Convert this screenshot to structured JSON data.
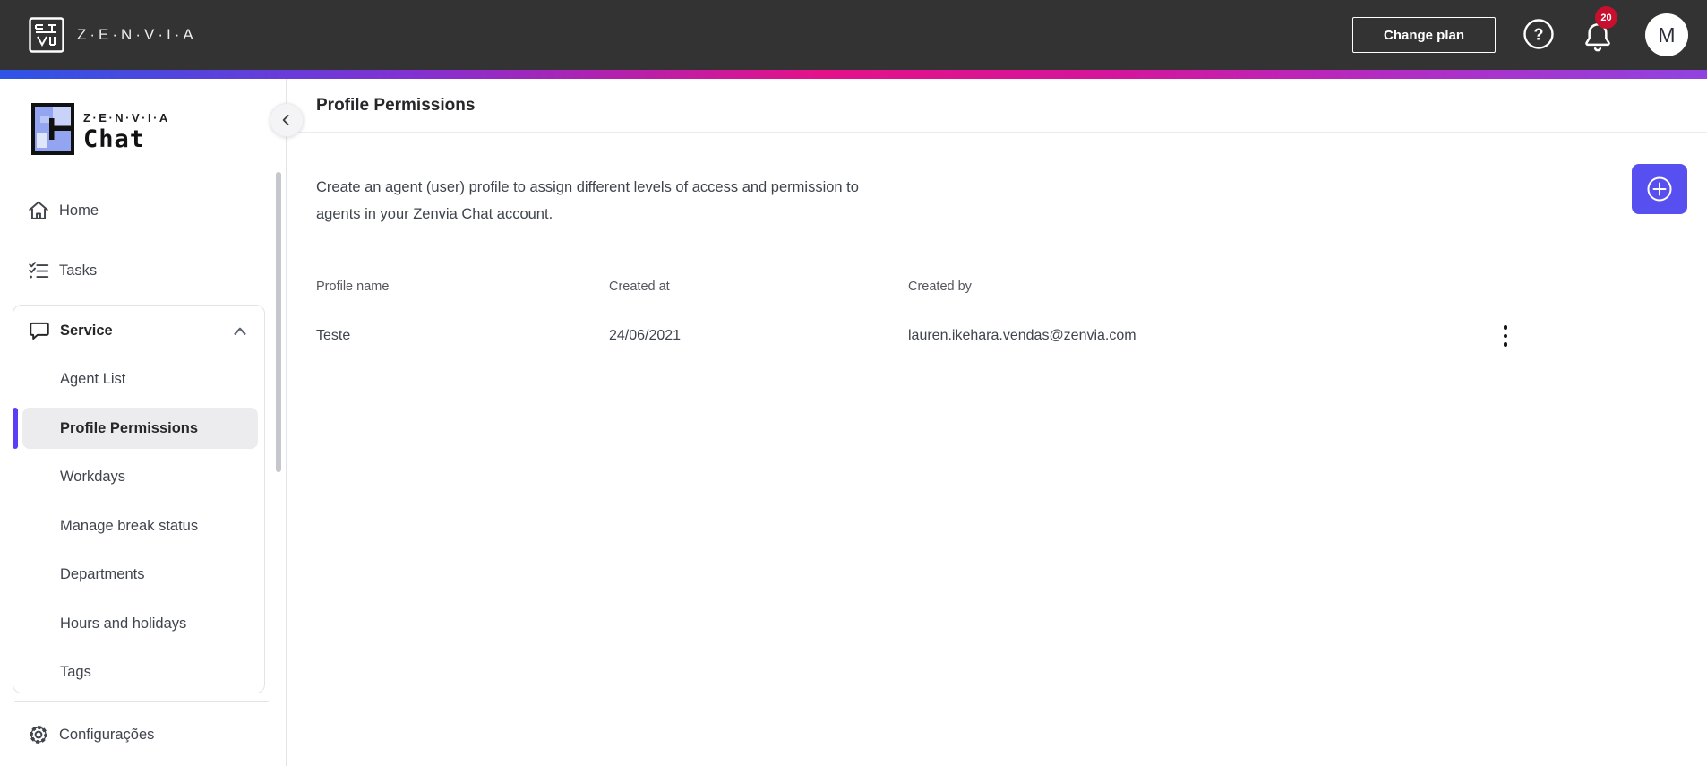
{
  "topbar": {
    "brand": "Z·E·N·V·I·A",
    "change_plan_label": "Change plan",
    "notification_count": "20",
    "avatar_initial": "M"
  },
  "sidebar": {
    "logo_brand": "Z·E·N·V·I·A",
    "logo_product": "Chat",
    "items": [
      {
        "label": "Home"
      },
      {
        "label": "Tasks"
      }
    ],
    "service_group": {
      "label": "Service",
      "items": [
        {
          "label": "Agent List",
          "active": false
        },
        {
          "label": "Profile Permissions",
          "active": true
        },
        {
          "label": "Workdays",
          "active": false
        },
        {
          "label": "Manage break status",
          "active": false
        },
        {
          "label": "Departments",
          "active": false
        },
        {
          "label": "Hours and holidays",
          "active": false
        },
        {
          "label": "Tags",
          "active": false
        }
      ]
    },
    "footer_item": {
      "label": "Configurações"
    }
  },
  "main": {
    "title": "Profile Permissions",
    "description": "Create an agent (user) profile to assign different levels of access and permission to agents in your Zenvia Chat account.",
    "table": {
      "columns": [
        "Profile name",
        "Created at",
        "Created by"
      ],
      "rows": [
        {
          "profile_name": "Teste",
          "created_at": "24/06/2021",
          "created_by": "lauren.ikehara.vendas@zenvia.com"
        }
      ]
    }
  },
  "icons": {
    "brand_mark": "zenvia-maze-logo",
    "help": "question-circle",
    "notifications": "bell",
    "home": "house",
    "tasks": "checklist",
    "service": "chat-bubble",
    "service_state": "chevron-up",
    "collapse": "chevron-left",
    "settings": "gear",
    "add": "plus-circle",
    "row_menu": "kebab-vertical"
  },
  "colors": {
    "topbar_bg": "#333333",
    "accent_button": "#584ff0",
    "active_item_bar": "#5b3df5",
    "badge_red": "#c8102e",
    "gradient_stops": [
      "#2d54e6",
      "#8231d2",
      "#e41289",
      "#b32cc2",
      "#9043e0"
    ]
  }
}
